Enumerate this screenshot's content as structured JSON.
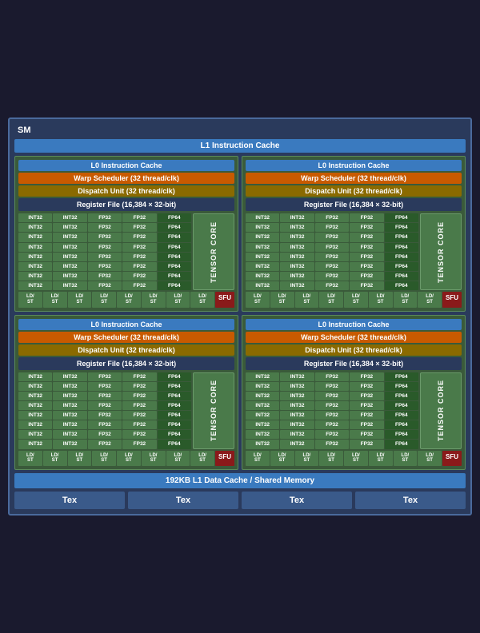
{
  "sm": {
    "label": "SM",
    "l1_instruction_cache": "L1 Instruction Cache",
    "l1_data_cache": "192KB L1 Data Cache / Shared Memory",
    "l0_cache": "L0 Instruction Cache",
    "warp_scheduler": "Warp Scheduler (32 thread/clk)",
    "dispatch_unit": "Dispatch Unit (32 thread/clk)",
    "register_file": "Register File (16,384 × 32-bit)",
    "tensor_core": "TENSOR CORE",
    "sfu": "SFU",
    "tex": "Tex",
    "alu_rows": [
      [
        "INT32",
        "INT32",
        "FP32",
        "FP32",
        "FP64"
      ],
      [
        "INT32",
        "INT32",
        "FP32",
        "FP32",
        "FP64"
      ],
      [
        "INT32",
        "INT32",
        "FP32",
        "FP32",
        "FP64"
      ],
      [
        "INT32",
        "INT32",
        "FP32",
        "FP32",
        "FP64"
      ],
      [
        "INT32",
        "INT32",
        "FP32",
        "FP32",
        "FP64"
      ],
      [
        "INT32",
        "INT32",
        "FP32",
        "FP32",
        "FP64"
      ],
      [
        "INT32",
        "INT32",
        "FP32",
        "FP32",
        "FP64"
      ],
      [
        "INT32",
        "INT32",
        "FP32",
        "FP32",
        "FP64"
      ]
    ],
    "ld_st_labels": [
      "LD/\nST",
      "LD/\nST",
      "LD/\nST",
      "LD/\nST",
      "LD/\nST",
      "LD/\nST",
      "LD/\nST",
      "LD/\nST"
    ],
    "colors": {
      "background": "#2a3a5c",
      "l0_cache_bg": "#3a7abf",
      "warp_bg": "#c85a00",
      "dispatch_bg": "#8a6a00",
      "register_bg": "#2a3a5c",
      "alu_bg": "#4a7a4a",
      "fp64_bg": "#2a5a2a",
      "tensor_bg": "#4a7a4a",
      "sfu_bg": "#8a1a1a",
      "tex_bg": "#3a5a8a",
      "l1_bg": "#3a7abf"
    }
  }
}
